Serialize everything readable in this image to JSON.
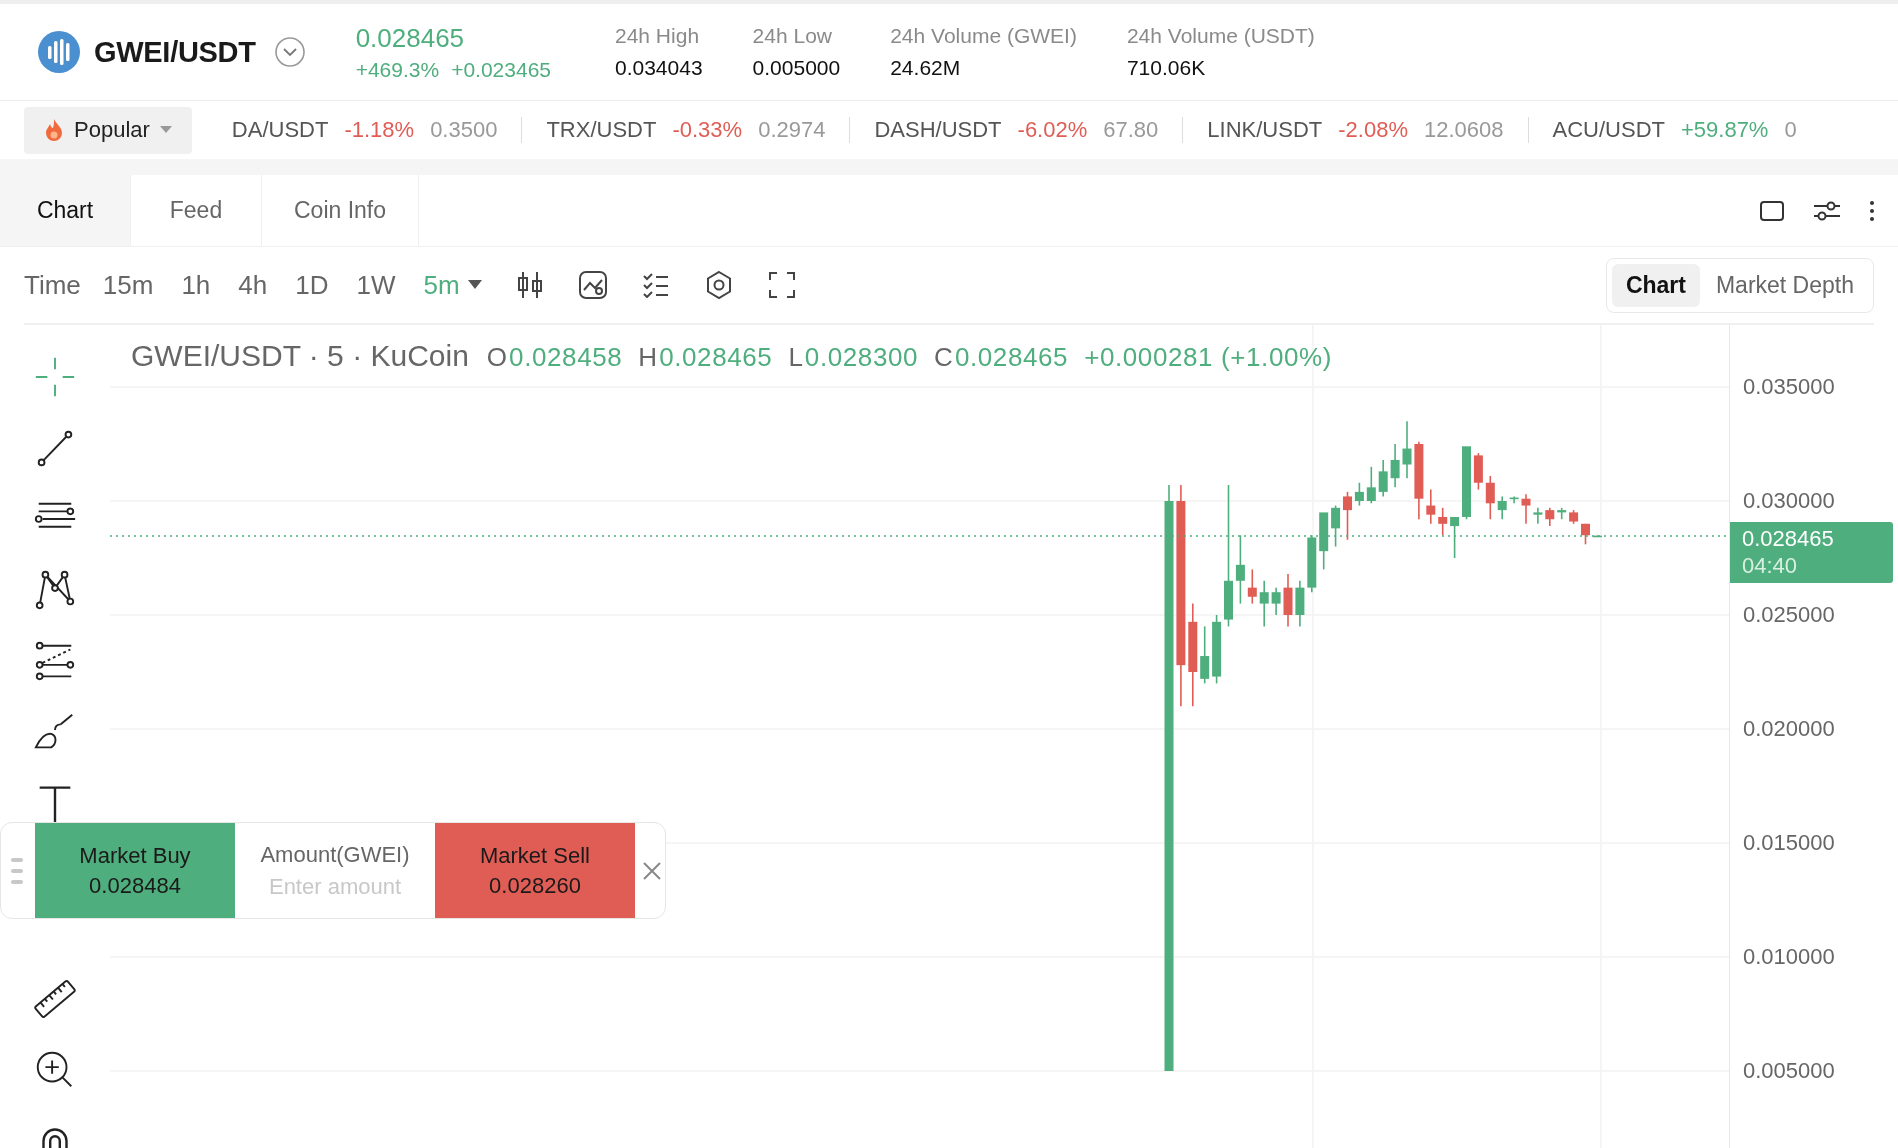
{
  "header": {
    "pair": "GWEI/USDT",
    "price": "0.028465",
    "change_percent": "+469.3%",
    "change_amount": "+0.023465",
    "stats": [
      {
        "label": "24h High",
        "value": "0.034043"
      },
      {
        "label": "24h Low",
        "value": "0.005000"
      },
      {
        "label": "24h Volume (GWEI)",
        "value": "24.62M"
      },
      {
        "label": "24h Volume (USDT)",
        "value": "710.06K"
      }
    ]
  },
  "ticker": {
    "filter": "Popular",
    "items": [
      {
        "pair": "DA/USDT",
        "change": "-1.18%",
        "price": "0.3500",
        "color": "#e05d55"
      },
      {
        "pair": "TRX/USDT",
        "change": "-0.33%",
        "price": "0.2974",
        "color": "#e05d55"
      },
      {
        "pair": "DASH/USDT",
        "change": "-6.02%",
        "price": "67.80",
        "color": "#e05d55"
      },
      {
        "pair": "LINK/USDT",
        "change": "-2.08%",
        "price": "12.0608",
        "color": "#e05d55"
      },
      {
        "pair": "ACU/USDT",
        "change": "+59.87%",
        "price": "0",
        "color": "#4fae7d"
      }
    ]
  },
  "tabs": [
    {
      "label": "Chart",
      "selected": true
    },
    {
      "label": "Feed",
      "selected": false
    },
    {
      "label": "Coin Info",
      "selected": false
    }
  ],
  "toolbar": {
    "time_label": "Time",
    "intervals": [
      {
        "label": "15m",
        "selected": false
      },
      {
        "label": "1h",
        "selected": false
      },
      {
        "label": "4h",
        "selected": false
      },
      {
        "label": "1D",
        "selected": false
      },
      {
        "label": "1W",
        "selected": false
      },
      {
        "label": "5m",
        "selected": true
      }
    ],
    "views": [
      {
        "label": "Chart",
        "selected": true
      },
      {
        "label": "Market Depth",
        "selected": false
      }
    ]
  },
  "chart": {
    "title": "GWEI/USDT · 5 · KuCoin",
    "ohlc": [
      {
        "label": "O",
        "value": "0.028458"
      },
      {
        "label": "H",
        "value": "0.028465"
      },
      {
        "label": "L",
        "value": "0.028300"
      },
      {
        "label": "C",
        "value": "0.028465"
      }
    ],
    "change": "+0.000281 (+1.00%)",
    "price_ticks": [
      "0.035000",
      "0.030000",
      "0.025000",
      "0.020000",
      "0.015000",
      "0.010000",
      "0.005000"
    ],
    "last_price": "0.028465",
    "countdown": "04:40"
  },
  "drawing_tools": [
    {
      "kind": "crosshair",
      "selected": true
    },
    {
      "kind": "trend-line",
      "selected": false
    },
    {
      "kind": "parallel-lines",
      "selected": false
    },
    {
      "kind": "pattern",
      "selected": false
    },
    {
      "kind": "fib",
      "selected": false
    },
    {
      "kind": "brush",
      "selected": false
    },
    {
      "kind": "text",
      "selected": false
    },
    {
      "kind": "ruler",
      "selected": false
    },
    {
      "kind": "zoom-in",
      "selected": false
    },
    {
      "kind": "magnet",
      "selected": false
    }
  ],
  "trade_panel": {
    "buy": {
      "label": "Market Buy",
      "price": "0.028484"
    },
    "amount_label": "Amount(GWEI)",
    "amount_placeholder": "Enter amount",
    "sell": {
      "label": "Market Sell",
      "price": "0.028260"
    }
  }
}
